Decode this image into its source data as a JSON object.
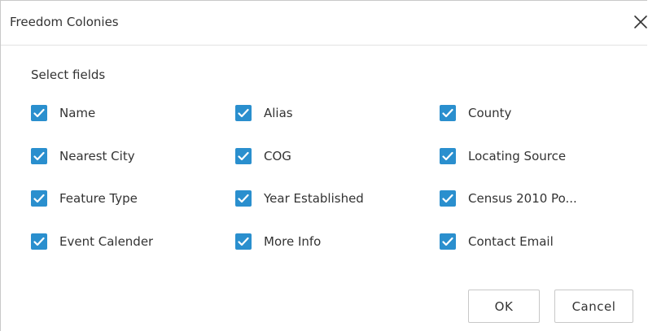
{
  "dialog": {
    "title": "Freedom Colonies",
    "section_label": "Select fields",
    "fields": [
      {
        "label": "Name",
        "checked": true
      },
      {
        "label": "Alias",
        "checked": true
      },
      {
        "label": "County",
        "checked": true
      },
      {
        "label": "Nearest City",
        "checked": true
      },
      {
        "label": "COG",
        "checked": true
      },
      {
        "label": "Locating Source",
        "checked": true
      },
      {
        "label": "Feature Type",
        "checked": true
      },
      {
        "label": "Year Established",
        "checked": true
      },
      {
        "label": "Census 2010 Po...",
        "checked": true
      },
      {
        "label": "Event Calender",
        "checked": true
      },
      {
        "label": "More Info",
        "checked": true
      },
      {
        "label": "Contact Email",
        "checked": true
      }
    ],
    "ok_label": "OK",
    "cancel_label": "Cancel"
  },
  "icons": {
    "close": "close-icon",
    "checkbox": "checkmark-icon"
  },
  "colors": {
    "checkbox_fill": "#2a8fce",
    "text": "#333333",
    "border": "#c8c8c8"
  }
}
